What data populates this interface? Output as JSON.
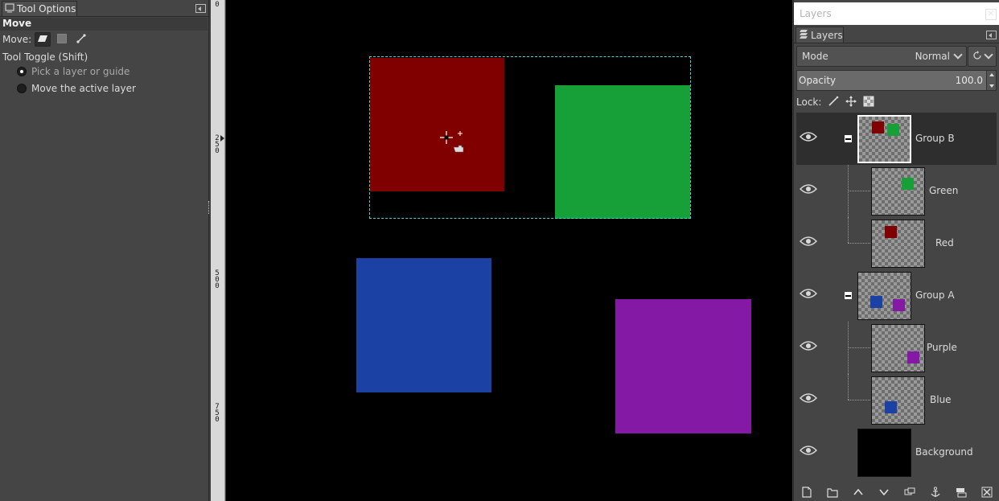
{
  "tool_options": {
    "tab_label": "Tool Options",
    "title": "Move",
    "move_label": "Move:",
    "toggle_label": "Tool Toggle  (Shift)",
    "options": [
      {
        "label": "Pick a layer or guide",
        "checked": true
      },
      {
        "label": "Move the active layer",
        "checked": false
      }
    ]
  },
  "ruler": {
    "labels": [
      "0",
      "2\n5\n0",
      "5\n0\n0",
      "7\n5\n0"
    ]
  },
  "canvas": {
    "shapes": [
      {
        "name": "red",
        "color": "#800000"
      },
      {
        "name": "green",
        "color": "#18a038"
      },
      {
        "name": "blue",
        "color": "#1b41a4"
      },
      {
        "name": "purple",
        "color": "#8419a6"
      }
    ],
    "selection_color": "#4fd2d2"
  },
  "layers_dock": {
    "window_title": "Layers",
    "tab_label": "Layers",
    "mode_label": "Mode",
    "mode_value": "Normal",
    "opacity_label": "Opacity",
    "opacity_value": "100.0",
    "lock_label": "Lock:",
    "layers": [
      {
        "name": "Group B",
        "type": "group",
        "selected": true,
        "visible": true
      },
      {
        "name": "Green",
        "type": "layer",
        "parent": "Group B",
        "visible": true
      },
      {
        "name": "Red",
        "type": "layer",
        "parent": "Group B",
        "visible": true
      },
      {
        "name": "Group A",
        "type": "group",
        "visible": true
      },
      {
        "name": "Purple",
        "type": "layer",
        "parent": "Group A",
        "visible": true
      },
      {
        "name": "Blue",
        "type": "layer",
        "parent": "Group A",
        "visible": true
      },
      {
        "name": "Background",
        "type": "layer",
        "visible": true
      }
    ],
    "bottom_icons": [
      "new-layer-icon",
      "new-group-icon",
      "raise-layer-icon",
      "lower-layer-icon",
      "duplicate-layer-icon",
      "anchor-layer-icon",
      "merge-down-icon",
      "delete-layer-icon"
    ]
  }
}
